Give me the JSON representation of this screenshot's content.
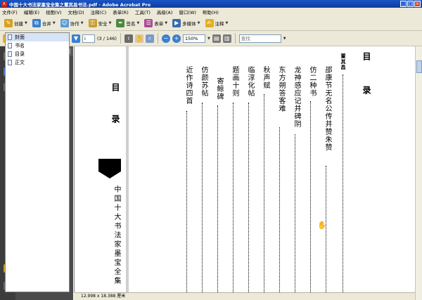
{
  "window": {
    "title": "中国十大书法家墨宝全集之董其昌书法.pdf - Adobe Acrobat Pro",
    "app_icon": "pdf-icon"
  },
  "menu": [
    "文件(F)",
    "编辑(E)",
    "视图(V)",
    "文档(D)",
    "注释(C)",
    "表单(R)",
    "工具(T)",
    "高级(A)",
    "窗口(W)",
    "帮助(H)"
  ],
  "toolbar1": {
    "create": "创建",
    "combine": "合并",
    "collaborate": "协作",
    "secure": "安全",
    "sign": "签名",
    "forms": "表单",
    "multimedia": "多媒体",
    "comment": "注释"
  },
  "toolbar2": {
    "page_number": "i",
    "page_count": "(3 / 146)",
    "zoom": "150%",
    "search_placeholder": "查找"
  },
  "bookmarks": {
    "title": "书签",
    "items": [
      {
        "label": "封面",
        "selected": true
      },
      {
        "label": "书名",
        "selected": false
      },
      {
        "label": "目录",
        "selected": false
      },
      {
        "label": "正文",
        "selected": false
      }
    ]
  },
  "page_left": {
    "heading_a": "目",
    "heading_b": "录",
    "book_title": "中国十大书法家墨宝全集"
  },
  "page_right": {
    "heading_a": "目",
    "heading_b": "录",
    "author": "董其昌",
    "entries": [
      "邵康节无名公传并赞朱赞",
      "仿二种书",
      "龙神感应记并碑阴",
      "东方朔答客难",
      "秋声赋",
      "临淳化帖",
      "题画十则",
      "寄鲸碑",
      "仿颜苏帖",
      "近作诗四首"
    ]
  },
  "statusbar": {
    "size": "12.998 x 18.388 厘米"
  },
  "colors": {
    "titlebar": "#1a55c8",
    "chrome": "#ece9d8",
    "panel": "#4a4a4a",
    "rail": "#3c3c3c"
  }
}
